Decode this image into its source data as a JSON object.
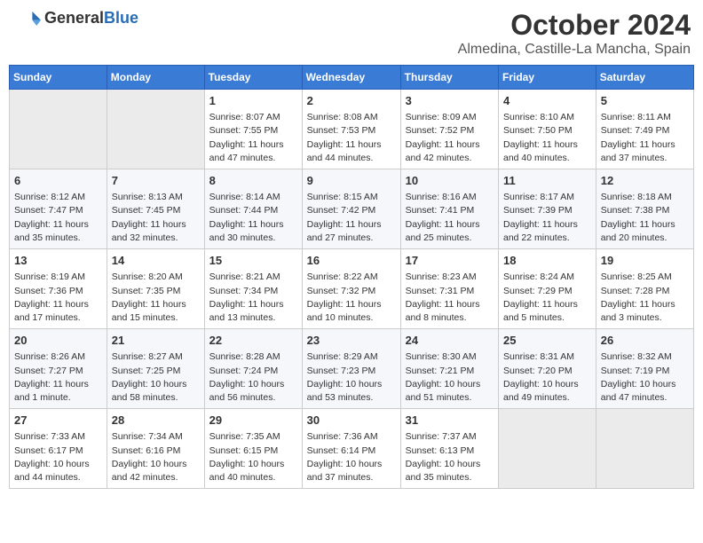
{
  "logo": {
    "general": "General",
    "blue": "Blue"
  },
  "title": {
    "month": "October 2024",
    "location": "Almedina, Castille-La Mancha, Spain"
  },
  "weekdays": [
    "Sunday",
    "Monday",
    "Tuesday",
    "Wednesday",
    "Thursday",
    "Friday",
    "Saturday"
  ],
  "weeks": [
    {
      "days": [
        {
          "num": "",
          "info": ""
        },
        {
          "num": "",
          "info": ""
        },
        {
          "num": "1",
          "info": "Sunrise: 8:07 AM\nSunset: 7:55 PM\nDaylight: 11 hours and 47 minutes."
        },
        {
          "num": "2",
          "info": "Sunrise: 8:08 AM\nSunset: 7:53 PM\nDaylight: 11 hours and 44 minutes."
        },
        {
          "num": "3",
          "info": "Sunrise: 8:09 AM\nSunset: 7:52 PM\nDaylight: 11 hours and 42 minutes."
        },
        {
          "num": "4",
          "info": "Sunrise: 8:10 AM\nSunset: 7:50 PM\nDaylight: 11 hours and 40 minutes."
        },
        {
          "num": "5",
          "info": "Sunrise: 8:11 AM\nSunset: 7:49 PM\nDaylight: 11 hours and 37 minutes."
        }
      ]
    },
    {
      "days": [
        {
          "num": "6",
          "info": "Sunrise: 8:12 AM\nSunset: 7:47 PM\nDaylight: 11 hours and 35 minutes."
        },
        {
          "num": "7",
          "info": "Sunrise: 8:13 AM\nSunset: 7:45 PM\nDaylight: 11 hours and 32 minutes."
        },
        {
          "num": "8",
          "info": "Sunrise: 8:14 AM\nSunset: 7:44 PM\nDaylight: 11 hours and 30 minutes."
        },
        {
          "num": "9",
          "info": "Sunrise: 8:15 AM\nSunset: 7:42 PM\nDaylight: 11 hours and 27 minutes."
        },
        {
          "num": "10",
          "info": "Sunrise: 8:16 AM\nSunset: 7:41 PM\nDaylight: 11 hours and 25 minutes."
        },
        {
          "num": "11",
          "info": "Sunrise: 8:17 AM\nSunset: 7:39 PM\nDaylight: 11 hours and 22 minutes."
        },
        {
          "num": "12",
          "info": "Sunrise: 8:18 AM\nSunset: 7:38 PM\nDaylight: 11 hours and 20 minutes."
        }
      ]
    },
    {
      "days": [
        {
          "num": "13",
          "info": "Sunrise: 8:19 AM\nSunset: 7:36 PM\nDaylight: 11 hours and 17 minutes."
        },
        {
          "num": "14",
          "info": "Sunrise: 8:20 AM\nSunset: 7:35 PM\nDaylight: 11 hours and 15 minutes."
        },
        {
          "num": "15",
          "info": "Sunrise: 8:21 AM\nSunset: 7:34 PM\nDaylight: 11 hours and 13 minutes."
        },
        {
          "num": "16",
          "info": "Sunrise: 8:22 AM\nSunset: 7:32 PM\nDaylight: 11 hours and 10 minutes."
        },
        {
          "num": "17",
          "info": "Sunrise: 8:23 AM\nSunset: 7:31 PM\nDaylight: 11 hours and 8 minutes."
        },
        {
          "num": "18",
          "info": "Sunrise: 8:24 AM\nSunset: 7:29 PM\nDaylight: 11 hours and 5 minutes."
        },
        {
          "num": "19",
          "info": "Sunrise: 8:25 AM\nSunset: 7:28 PM\nDaylight: 11 hours and 3 minutes."
        }
      ]
    },
    {
      "days": [
        {
          "num": "20",
          "info": "Sunrise: 8:26 AM\nSunset: 7:27 PM\nDaylight: 11 hours and 1 minute."
        },
        {
          "num": "21",
          "info": "Sunrise: 8:27 AM\nSunset: 7:25 PM\nDaylight: 10 hours and 58 minutes."
        },
        {
          "num": "22",
          "info": "Sunrise: 8:28 AM\nSunset: 7:24 PM\nDaylight: 10 hours and 56 minutes."
        },
        {
          "num": "23",
          "info": "Sunrise: 8:29 AM\nSunset: 7:23 PM\nDaylight: 10 hours and 53 minutes."
        },
        {
          "num": "24",
          "info": "Sunrise: 8:30 AM\nSunset: 7:21 PM\nDaylight: 10 hours and 51 minutes."
        },
        {
          "num": "25",
          "info": "Sunrise: 8:31 AM\nSunset: 7:20 PM\nDaylight: 10 hours and 49 minutes."
        },
        {
          "num": "26",
          "info": "Sunrise: 8:32 AM\nSunset: 7:19 PM\nDaylight: 10 hours and 47 minutes."
        }
      ]
    },
    {
      "days": [
        {
          "num": "27",
          "info": "Sunrise: 7:33 AM\nSunset: 6:17 PM\nDaylight: 10 hours and 44 minutes."
        },
        {
          "num": "28",
          "info": "Sunrise: 7:34 AM\nSunset: 6:16 PM\nDaylight: 10 hours and 42 minutes."
        },
        {
          "num": "29",
          "info": "Sunrise: 7:35 AM\nSunset: 6:15 PM\nDaylight: 10 hours and 40 minutes."
        },
        {
          "num": "30",
          "info": "Sunrise: 7:36 AM\nSunset: 6:14 PM\nDaylight: 10 hours and 37 minutes."
        },
        {
          "num": "31",
          "info": "Sunrise: 7:37 AM\nSunset: 6:13 PM\nDaylight: 10 hours and 35 minutes."
        },
        {
          "num": "",
          "info": ""
        },
        {
          "num": "",
          "info": ""
        }
      ]
    }
  ]
}
